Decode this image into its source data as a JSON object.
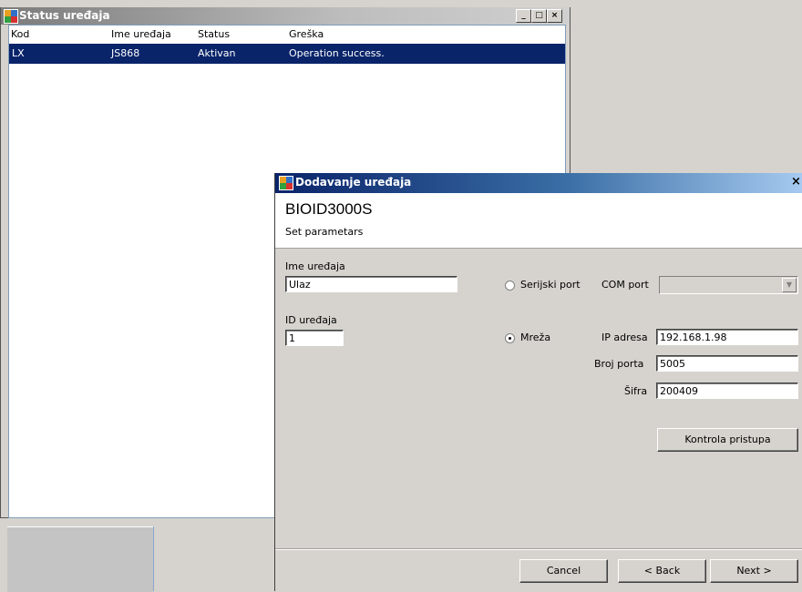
{
  "status_window": {
    "title": "Status uređaja",
    "caption_buttons": {
      "minimize": "_",
      "maximize": "□",
      "close": "×"
    },
    "columns": [
      "Kod",
      "Ime uređaja",
      "Status",
      "Greška"
    ],
    "rows": [
      {
        "kod": "LX",
        "ime": "JS868",
        "status": "Aktivan",
        "greska": "Operation success."
      }
    ]
  },
  "dialog": {
    "title": "Dodavanje uređaja",
    "close_glyph": "×",
    "heading": "BIOID3000S",
    "subheading": "Set parametars",
    "device_name_label": "Ime uređaja",
    "device_name_value": "Ulaz",
    "device_id_label": "ID uređaja",
    "device_id_value": "1",
    "serial_radio_label": "Serijski port",
    "network_radio_label": "Mreža",
    "selected_connection": "Mreža",
    "com_port_label": "COM port",
    "com_port_value": "",
    "ip_label": "IP adresa",
    "ip_value": "192.168.1.98",
    "port_label": "Broj porta",
    "port_value": "5005",
    "password_label": "Šifra",
    "password_value": "200409",
    "access_button": "Kontrola pristupa",
    "cancel_button": "Cancel",
    "back_button": "< Back",
    "next_button": "Next >"
  }
}
